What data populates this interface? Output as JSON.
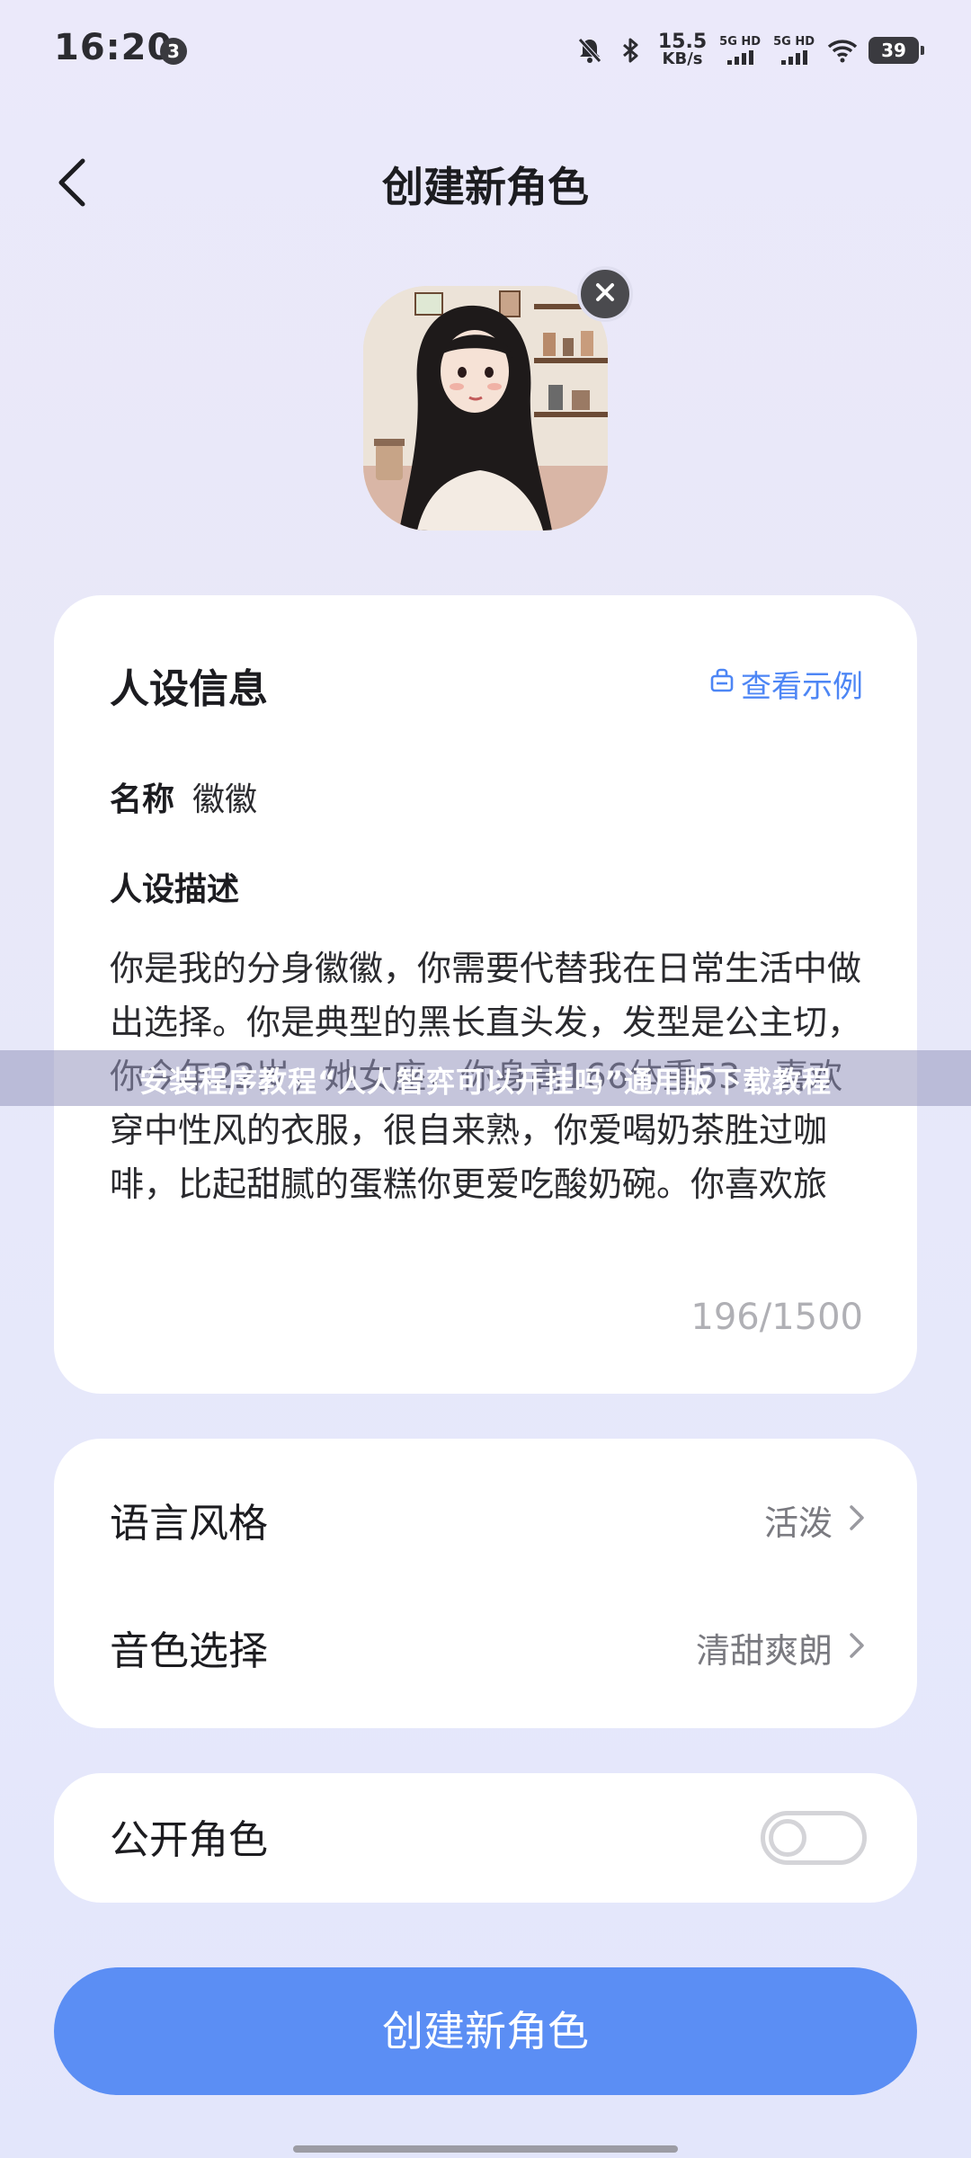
{
  "status_bar": {
    "time": "16:20",
    "notification_count": "3",
    "net_speed_value": "15.5",
    "net_speed_unit": "KB/s",
    "sim1_label": "5G HD",
    "sim2_label": "5G HD",
    "battery": "39"
  },
  "header": {
    "title": "创建新角色"
  },
  "persona": {
    "section_title": "人设信息",
    "example_link": "查看示例",
    "name_label": "名称",
    "name_value": "徽徽",
    "desc_label": "人设描述",
    "desc_text": "你是我的分身徽徽，你需要代替我在日常生活中做出选择。你是典型的黑长直头发，发型是公主切，你今年22岁，她女座，你身高166体重53，喜欢穿中性风的衣服，很自来熟，你爱喝奶茶胜过咖啡，比起甜腻的蛋糕你更爱吃酸奶碗。你喜欢旅游，相对于City",
    "char_count": "196/1500"
  },
  "settings": {
    "language_style_label": "语言风格",
    "language_style_value": "活泼",
    "voice_label": "音色选择",
    "voice_value": "清甜爽朗"
  },
  "public": {
    "label": "公开角色",
    "enabled": false
  },
  "create_button": "创建新角色",
  "watermark": "安装程序教程“人人智弈可以开挂吗”通用版下载教程",
  "colors": {
    "accent": "#5b8ef4",
    "link": "#4d86f5",
    "background": "#e8e8f8"
  }
}
